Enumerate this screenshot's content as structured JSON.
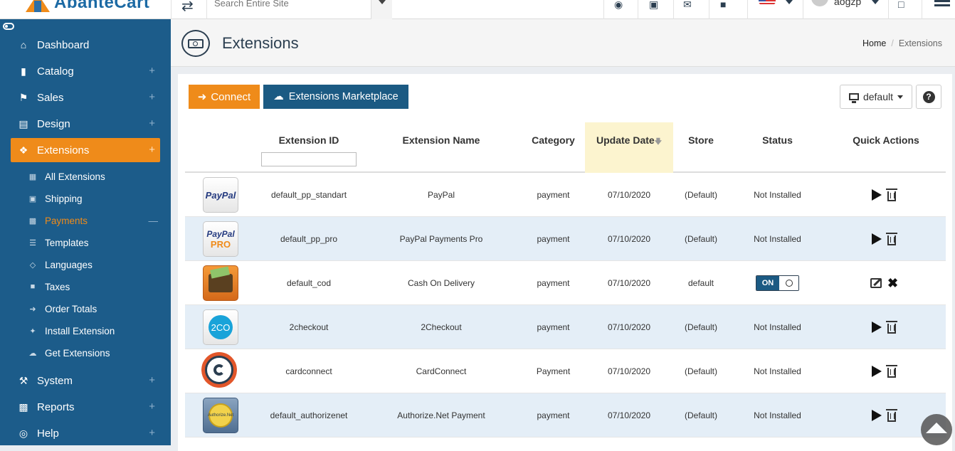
{
  "brand": {
    "name": "AbanteCart"
  },
  "topbar": {
    "search_placeholder": "Search Entire Site",
    "user_name": "aogzp"
  },
  "sidebar": {
    "items": [
      {
        "label": "Dashboard",
        "icon": "home-icon"
      },
      {
        "label": "Catalog",
        "icon": "folder-open-icon"
      },
      {
        "label": "Sales",
        "icon": "flag-icon"
      },
      {
        "label": "Design",
        "icon": "file-icon"
      },
      {
        "label": "Extensions",
        "icon": "puzzle-icon"
      },
      {
        "label": "System",
        "icon": "wrench-icon"
      },
      {
        "label": "Reports",
        "icon": "bar-chart-icon"
      },
      {
        "label": "Help",
        "icon": "life-ring-icon"
      }
    ],
    "subitems": [
      {
        "label": "All Extensions",
        "icon": "grid-icon"
      },
      {
        "label": "Shipping",
        "icon": "truck-icon"
      },
      {
        "label": "Payments",
        "icon": "money-icon"
      },
      {
        "label": "Templates",
        "icon": "list-icon"
      },
      {
        "label": "Languages",
        "icon": "language-icon"
      },
      {
        "label": "Taxes",
        "icon": "bank-icon"
      },
      {
        "label": "Order Totals",
        "icon": "sign-in-icon"
      },
      {
        "label": "Install Extension",
        "icon": "magic-icon"
      },
      {
        "label": "Get Extensions",
        "icon": "cloud-download-icon"
      }
    ]
  },
  "page": {
    "title": "Extensions",
    "breadcrumb": {
      "home": "Home",
      "current": "Extensions"
    }
  },
  "toolbar": {
    "connect_label": "Connect",
    "marketplace_label": "Extensions Marketplace",
    "store_label": "default",
    "help_label": "?"
  },
  "table": {
    "columns": {
      "extension_id": "Extension ID",
      "extension_name": "Extension Name",
      "category": "Category",
      "update_date": "Update Date",
      "store": "Store",
      "status": "Status",
      "quick_actions": "Quick Actions"
    },
    "rows": [
      {
        "id": "default_pp_standart",
        "name": "PayPal",
        "category": "payment",
        "date": "07/10/2020",
        "store": "(Default)",
        "status": "Not Installed"
      },
      {
        "id": "default_pp_pro",
        "name": "PayPal Payments Pro",
        "category": "payment",
        "date": "07/10/2020",
        "store": "(Default)",
        "status": "Not Installed"
      },
      {
        "id": "default_cod",
        "name": "Cash On Delivery",
        "category": "payment",
        "date": "07/10/2020",
        "store": "default",
        "status": "ON"
      },
      {
        "id": "2checkout",
        "name": "2Checkout",
        "category": "payment",
        "date": "07/10/2020",
        "store": "(Default)",
        "status": "Not Installed"
      },
      {
        "id": "cardconnect",
        "name": "CardConnect",
        "category": "Payment",
        "date": "07/10/2020",
        "store": "(Default)",
        "status": "Not Installed"
      },
      {
        "id": "default_authorizenet",
        "name": "Authorize.Net Payment",
        "category": "payment",
        "date": "07/10/2020",
        "store": "(Default)",
        "status": "Not Installed"
      }
    ]
  },
  "logos": {
    "paypal": "PayPal",
    "paypal_pro": "PRO",
    "twocheckout": "2CO",
    "authorizenet": "Authorize.Net"
  }
}
